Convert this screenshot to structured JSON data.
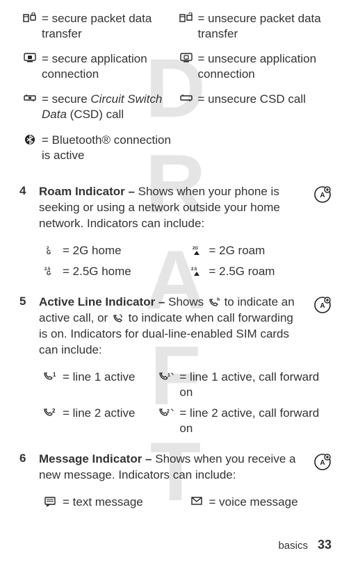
{
  "watermark": "DRAFT",
  "top_grid": {
    "secure_packet": "= secure packet data transfer",
    "unsecure_packet": "= unsecure packet data transfer",
    "secure_app": "= secure application connection",
    "unsecure_app": "= unsecure application connection",
    "secure_csd_prefix": "= secure ",
    "secure_csd_italic": "Circuit Switch Data",
    "secure_csd_suffix": " (CSD) call",
    "unsecure_csd": "= unsecure CSD call",
    "bluetooth": "= Bluetooth® connection is active"
  },
  "section4": {
    "num": "4",
    "title": "Roam Indicator – ",
    "desc": "Shows when your phone is seeking or using a network outside your home network. Indicators can include:",
    "grid": {
      "g2_home": "= 2G home",
      "g2_roam": "= 2G roam",
      "g25_home": "= 2.5G home",
      "g25_roam": "= 2.5G roam"
    }
  },
  "section5": {
    "num": "5",
    "title": "Active Line Indicator – ",
    "desc_pre": "Shows ",
    "desc_mid": " to indicate an active call, or ",
    "desc_post": " to indicate when call forwarding is on. Indicators for dual-line-enabled SIM cards can include:",
    "grid": {
      "l1_active": "= line 1 active",
      "l1_fwd": "= line 1 active, call forward on",
      "l2_active": "= line 2 active",
      "l2_fwd": "= line 2 active, call forward on"
    }
  },
  "section6": {
    "num": "6",
    "title": "Message Indicator – ",
    "desc": "Shows when you receive a new message. Indicators can include:",
    "grid": {
      "text_msg": "= text message",
      "voice_msg": "= voice message"
    }
  },
  "footer": {
    "label": "basics",
    "page": "33"
  }
}
